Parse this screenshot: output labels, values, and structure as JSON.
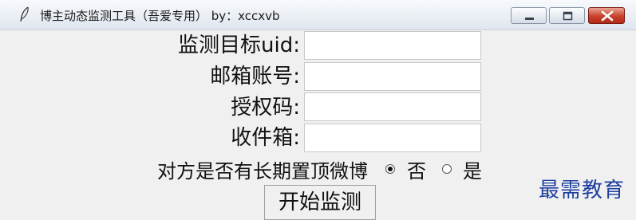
{
  "window": {
    "title": "博主动态监测工具（吾爱专用） by：xccxvb",
    "icon": "feather-icon",
    "controls": [
      "minimize-icon",
      "maximize-icon",
      "close-icon"
    ]
  },
  "form": {
    "uid_label": "监测目标uid:",
    "uid_value": "",
    "email_label": "邮箱账号:",
    "email_value": "",
    "auth_label": "授权码:",
    "auth_value": "",
    "inbox_label": "收件箱:",
    "inbox_value": ""
  },
  "pin_option": {
    "question": "对方是否有长期置顶微博",
    "no_label": "否",
    "yes_label": "是",
    "selected": "否"
  },
  "actions": {
    "start_label": "开始监测"
  },
  "watermark": "最需教育",
  "colors": {
    "window_bg": "#f0f0f0",
    "close_button": "#c7402a",
    "watermark": "#1f3fa0"
  }
}
